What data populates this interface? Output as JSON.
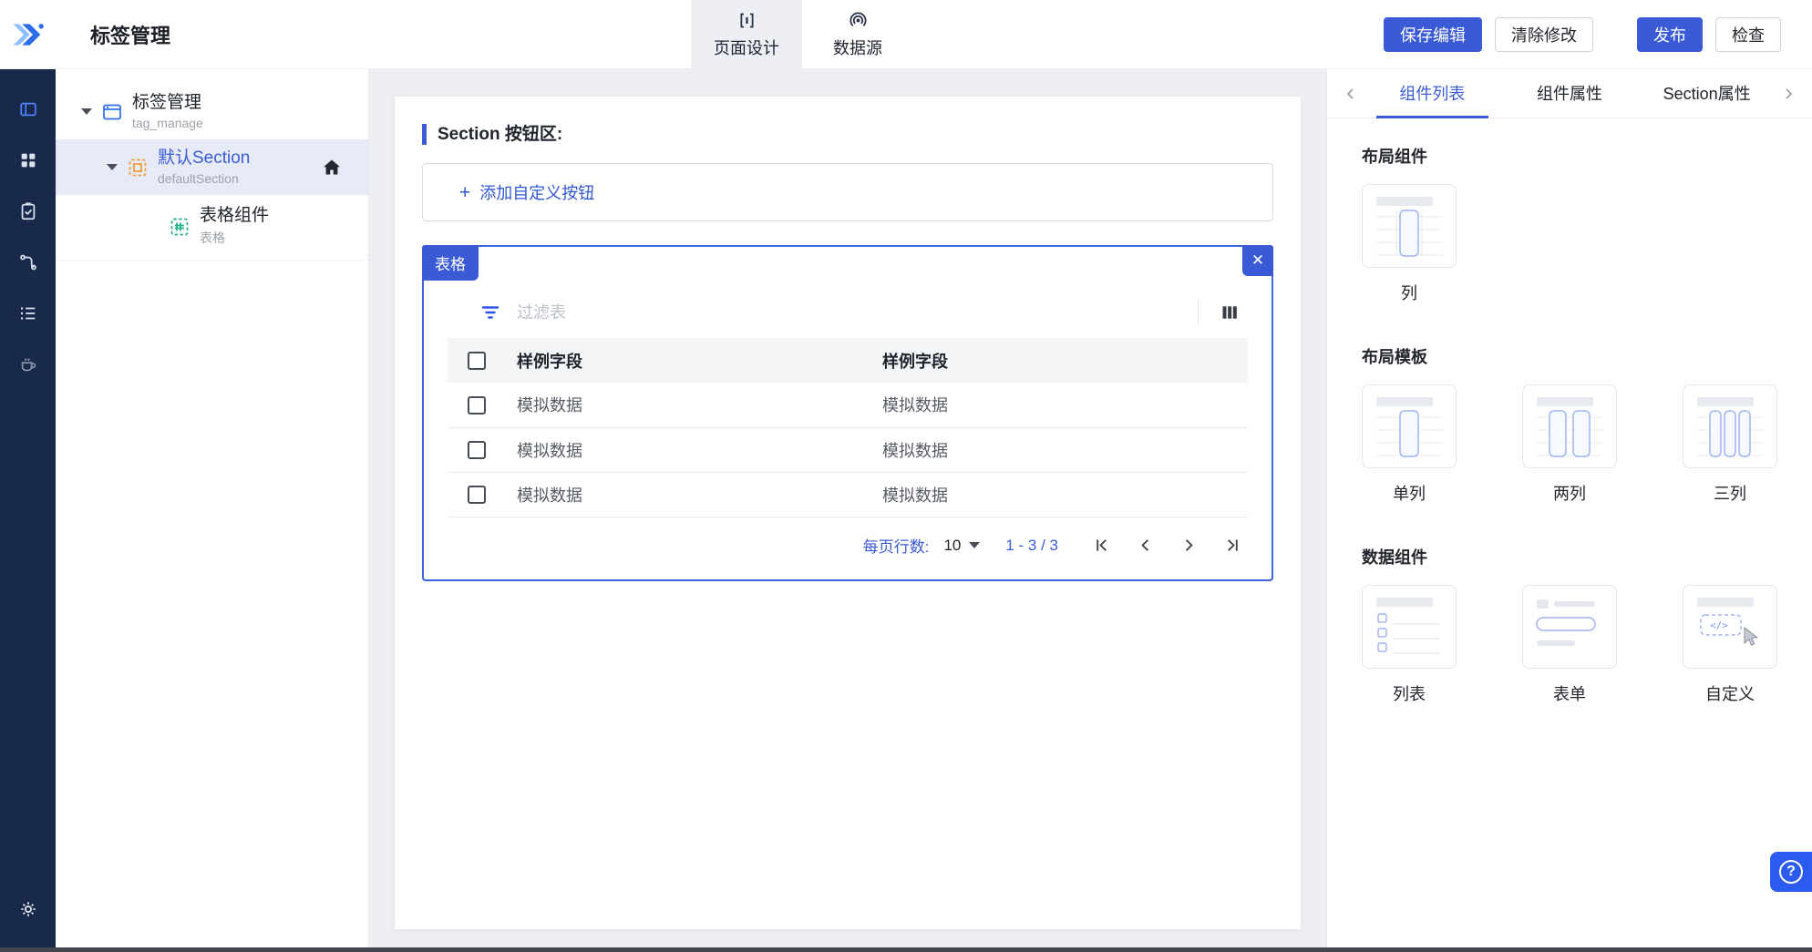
{
  "header": {
    "title": "标签管理",
    "tabs": [
      {
        "label": "页面设计"
      },
      {
        "label": "数据源"
      }
    ],
    "actions": {
      "save": "保存编辑",
      "clear": "清除修改",
      "publish": "发布",
      "check": "检查"
    }
  },
  "tree": {
    "root": {
      "label": "标签管理",
      "sub": "tag_manage"
    },
    "section": {
      "label": "默认Section",
      "sub": "defaultSection"
    },
    "table": {
      "label": "表格组件",
      "sub": "表格"
    }
  },
  "canvas": {
    "section_title": "Section 按钮区:",
    "add_plus": "+",
    "add_label": "添加自定义按钮",
    "table": {
      "badge": "表格",
      "close": "✕",
      "filter_placeholder": "过滤表",
      "columns": [
        "样例字段",
        "样例字段"
      ],
      "rows": [
        [
          "模拟数据",
          "模拟数据"
        ],
        [
          "模拟数据",
          "模拟数据"
        ],
        [
          "模拟数据",
          "模拟数据"
        ]
      ],
      "pagination": {
        "per_page_label": "每页行数:",
        "per_page_value": "10",
        "range": "1 - 3 / 3"
      }
    }
  },
  "right_panel": {
    "tabs": [
      {
        "label": "组件列表"
      },
      {
        "label": "组件属性"
      },
      {
        "label": "Section属性"
      }
    ],
    "sections": [
      {
        "title": "布局组件",
        "cards": [
          {
            "label": "列"
          }
        ]
      },
      {
        "title": "布局模板",
        "cards": [
          {
            "label": "单列"
          },
          {
            "label": "两列"
          },
          {
            "label": "三列"
          }
        ]
      },
      {
        "title": "数据组件",
        "cards": [
          {
            "label": "列表"
          },
          {
            "label": "表单"
          },
          {
            "label": "自定义"
          }
        ]
      }
    ]
  },
  "help": {
    "label": "?"
  },
  "colors": {
    "primary": "#3b5bd6",
    "rail_bg": "#18294b",
    "selected_row": "#e7ebf8",
    "canvas_bg": "#edeff3",
    "widget_border": "#3f63e0",
    "section_icon_orange": "#f49d3f",
    "table_icon_green": "#23b288"
  }
}
